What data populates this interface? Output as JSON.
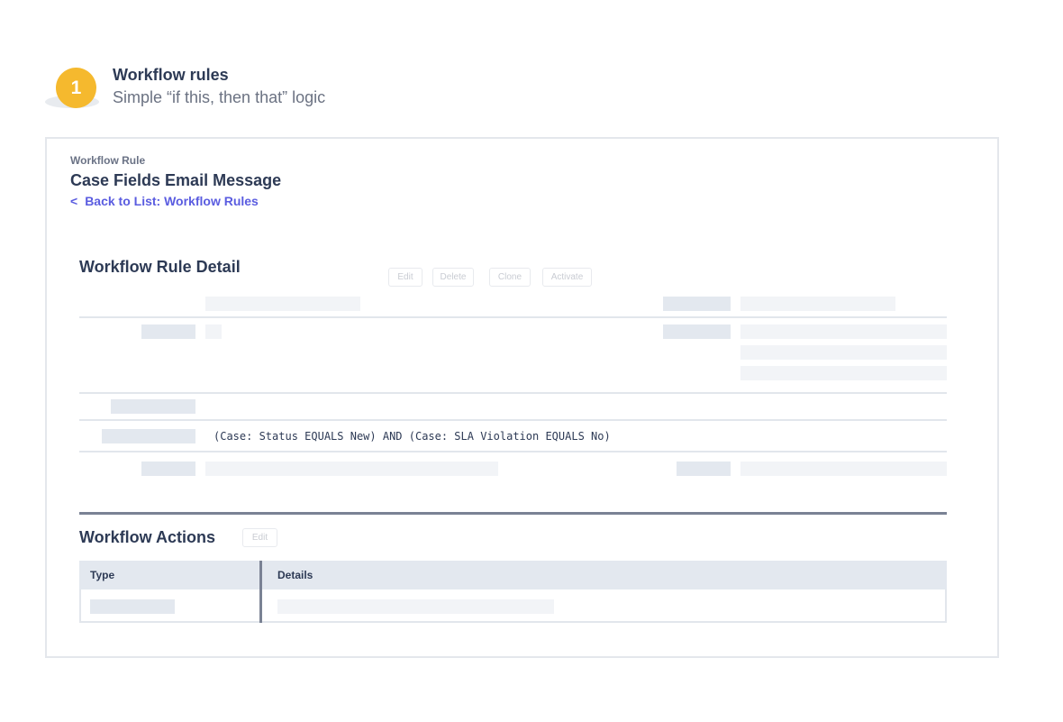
{
  "step": {
    "number": "1",
    "title": "Workflow rules",
    "subtitle": "Simple “if this, then that” logic"
  },
  "header": {
    "label": "Workflow Rule",
    "title": "Case Fields Email Message",
    "back_chevron": "<",
    "back_link": "Back to List: Workflow Rules"
  },
  "detail": {
    "title": "Workflow Rule Detail",
    "buttons": {
      "edit": "Edit",
      "delete": "Delete",
      "clone": "Clone",
      "activate": "Activate"
    },
    "rule_criteria": "(Case: Status EQUALS New) AND (Case: SLA Violation EQUALS No)"
  },
  "actions": {
    "title": "Workflow Actions",
    "edit_button": "Edit",
    "columns": [
      "Type",
      "Details"
    ]
  },
  "colors": {
    "accent": "#f5b92e",
    "link": "#5a5ce0",
    "heading": "#2d3a55",
    "placeholder": "#e3e8ef"
  }
}
